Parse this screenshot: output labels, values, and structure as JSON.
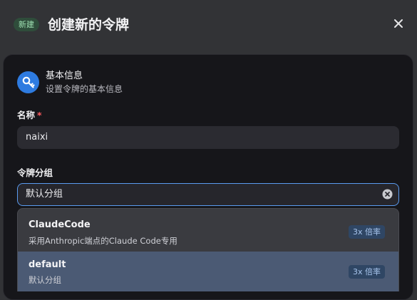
{
  "header": {
    "badge": "新建",
    "title": "创建新的令牌",
    "close_icon": "close-icon"
  },
  "section": {
    "icon": "key-icon",
    "title": "基本信息",
    "subtitle": "设置令牌的基本信息"
  },
  "fields": {
    "name": {
      "label": "名称",
      "required_mark": "*",
      "value": "naixi"
    },
    "group": {
      "label": "令牌分组",
      "value": "默认分组",
      "clear_icon": "clear-icon"
    }
  },
  "dropdown": {
    "options": [
      {
        "name": "ClaudeCode",
        "description": "采用Anthropic端点的Claude Code专用",
        "ratio": "3x 倍率",
        "selected": false
      },
      {
        "name": "default",
        "description": "默认分组",
        "ratio": "3x 倍率",
        "selected": true
      }
    ]
  },
  "colors": {
    "accent": "#2e7be0",
    "focus_border": "#5a9bf0",
    "required": "#ff5a5f",
    "badge_bg": "#2f4d3b",
    "badge_text": "#9ee0b2",
    "selected_option_bg": "#4b5a74"
  }
}
